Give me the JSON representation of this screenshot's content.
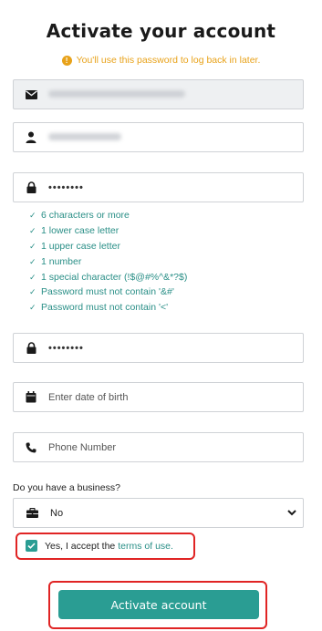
{
  "header": {
    "title": "Activate your account",
    "notice": "You'll use this password to log back in later."
  },
  "fields": {
    "email": {
      "icon": "envelope-icon",
      "value_obscured": true
    },
    "name": {
      "icon": "user-icon",
      "value_obscured": true
    },
    "password": {
      "icon": "lock-icon",
      "value": "••••••••"
    },
    "confirm_password": {
      "icon": "lock-icon",
      "value": "••••••••"
    },
    "dob": {
      "icon": "calendar-icon",
      "placeholder": "Enter date of birth"
    },
    "phone": {
      "icon": "phone-icon",
      "placeholder": "Phone Number"
    }
  },
  "password_rules": [
    "6 characters or more",
    "1 lower case letter",
    "1 upper case letter",
    "1 number",
    "1 special character (!$@#%^&*?$)",
    "Password must not contain '&#'",
    "Password must not contain '<'"
  ],
  "business": {
    "label": "Do you have a business?",
    "selected": "No",
    "icon": "briefcase-icon"
  },
  "terms": {
    "text": "Yes, I accept the",
    "link": "terms of use.",
    "checked": true
  },
  "submit": {
    "label": "Activate account"
  },
  "colors": {
    "accent": "#2a9d93",
    "notice": "#e8a21a",
    "highlight": "#e02424"
  }
}
